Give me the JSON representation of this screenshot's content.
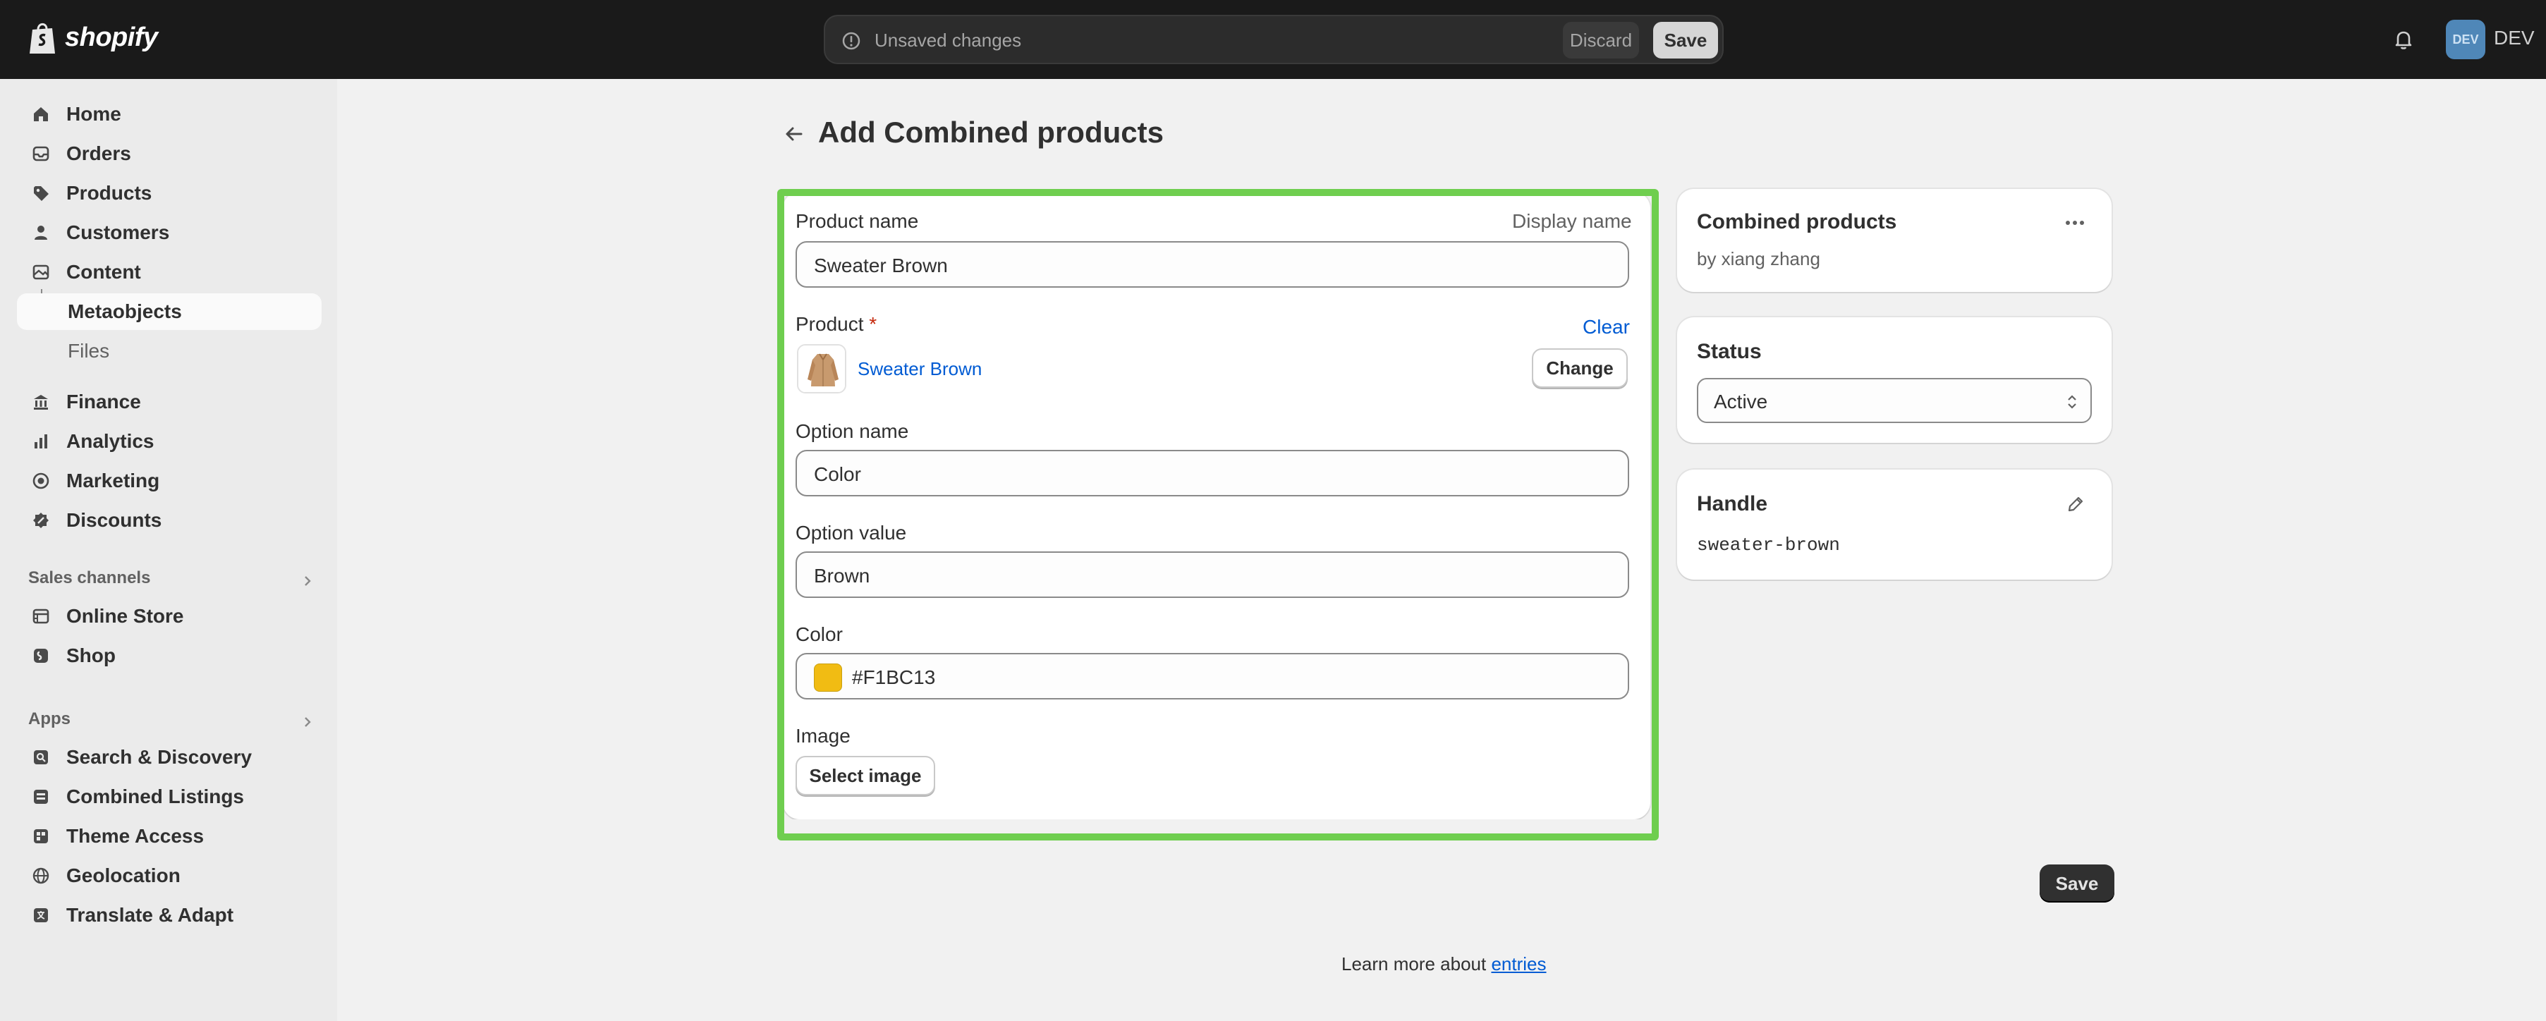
{
  "topbar": {
    "logo_text": "shopify",
    "unsaved_text": "Unsaved changes",
    "discard_label": "Discard",
    "save_label": "Save",
    "avatar_initials": "DEV",
    "store_name": "DEV"
  },
  "sidebar": {
    "items": [
      {
        "label": "Home",
        "icon": "home-icon"
      },
      {
        "label": "Orders",
        "icon": "inbox-icon"
      },
      {
        "label": "Products",
        "icon": "tag-icon"
      },
      {
        "label": "Customers",
        "icon": "person-icon"
      },
      {
        "label": "Content",
        "icon": "image-icon"
      },
      {
        "label": "Metaobjects",
        "icon": ""
      },
      {
        "label": "Files",
        "icon": ""
      },
      {
        "label": "Finance",
        "icon": "bank-icon"
      },
      {
        "label": "Analytics",
        "icon": "chart-icon"
      },
      {
        "label": "Marketing",
        "icon": "target-icon"
      },
      {
        "label": "Discounts",
        "icon": "discount-icon"
      }
    ],
    "sales_channels_heading": "Sales channels",
    "sales_channels": [
      {
        "label": "Online Store",
        "icon": "store-icon"
      },
      {
        "label": "Shop",
        "icon": "shop-icon"
      }
    ],
    "apps_heading": "Apps",
    "apps": [
      {
        "label": "Search & Discovery",
        "icon": "app-search-icon"
      },
      {
        "label": "Combined Listings",
        "icon": "app-listing-icon"
      },
      {
        "label": "Theme Access",
        "icon": "app-theme-icon"
      },
      {
        "label": "Geolocation",
        "icon": "globe-icon"
      },
      {
        "label": "Translate & Adapt",
        "icon": "app-translate-icon"
      }
    ]
  },
  "page": {
    "title": "Add Combined products"
  },
  "form": {
    "product_name_label": "Product name",
    "display_name_label": "Display name",
    "product_name_value": "Sweater Brown",
    "product_label": "Product",
    "required_mark": "*",
    "clear_label": "Clear",
    "product_link": "Sweater Brown",
    "change_label": "Change",
    "option_name_label": "Option name",
    "option_name_value": "Color",
    "option_value_label": "Option value",
    "option_value_value": "Brown",
    "color_label": "Color",
    "color_value": "#F1BC13",
    "image_label": "Image",
    "select_image_label": "Select image"
  },
  "right": {
    "definition_title": "Combined products",
    "definition_author": "by xiang zhang",
    "status_title": "Status",
    "status_value": "Active",
    "handle_title": "Handle",
    "handle_value": "sweater-brown"
  },
  "footer": {
    "save_label": "Save",
    "learn_more_prefix": "Learn more about ",
    "learn_more_link": "entries"
  },
  "colors": {
    "topbar": "#1a1a1a",
    "highlight": "#6fce4f",
    "swatch": "#F1BC13",
    "link": "#005bd3"
  }
}
